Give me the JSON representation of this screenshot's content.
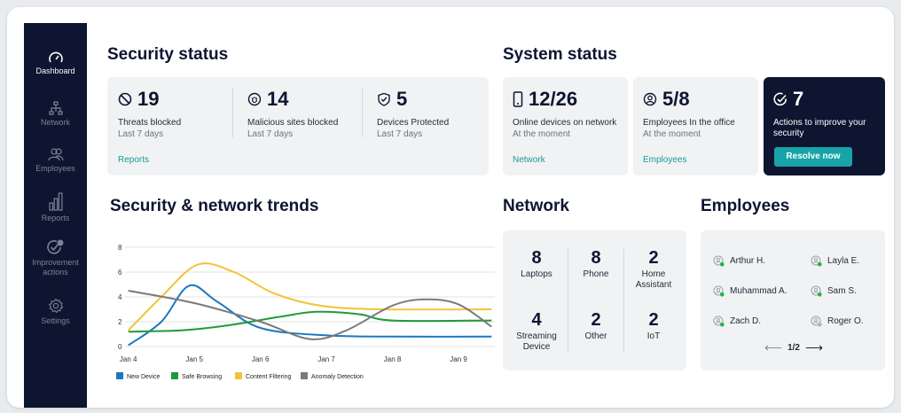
{
  "sidebar": {
    "items": [
      {
        "label": "Dashboard",
        "icon": "gauge-icon",
        "active": true
      },
      {
        "label": "Network",
        "icon": "network-icon",
        "active": false
      },
      {
        "label": "Employees",
        "icon": "users-icon",
        "active": false
      },
      {
        "label": "Reports",
        "icon": "bar-chart-icon",
        "active": false
      },
      {
        "label": "Improvement actions",
        "label_line1": "Improvement",
        "label_line2": "actions",
        "icon": "shield-badge-icon",
        "active": false
      },
      {
        "label": "Settings",
        "icon": "gear-icon",
        "active": false
      }
    ]
  },
  "security_status": {
    "title": "Security status",
    "stats": [
      {
        "value": "19",
        "label": "Threats blocked",
        "sub": "Last 7 days",
        "icon": "block-icon"
      },
      {
        "value": "14",
        "label": "Malicious sites blocked",
        "sub": "Last 7 days",
        "icon": "bug-icon"
      },
      {
        "value": "5",
        "label": "Devices Protected",
        "sub": "Last 7 days",
        "icon": "shield-check-icon"
      }
    ],
    "link": "Reports"
  },
  "system_status": {
    "title": "System status",
    "cards": [
      {
        "value": "12/26",
        "label": "Online devices on network",
        "sub": "At the moment",
        "link": "Network",
        "icon": "phone-icon"
      },
      {
        "value": "5/8",
        "label": "Employees In the office",
        "sub": "At the moment",
        "link": "Employees",
        "icon": "user-circle-icon"
      }
    ],
    "actions": {
      "value": "7",
      "label": "Actions to improve your security",
      "button": "Resolve now",
      "icon": "check-circle-icon"
    }
  },
  "trends": {
    "title": "Security & network trends"
  },
  "network": {
    "title": "Network",
    "cells": [
      {
        "value": "8",
        "label": "Laptops"
      },
      {
        "value": "8",
        "label": "Phone"
      },
      {
        "value": "2",
        "label": "Home Assistant",
        "label_line1": "Home",
        "label_line2": "Assistant"
      },
      {
        "value": "4",
        "label": "Streaming Device",
        "label_line1": "Streaming",
        "label_line2": "Device"
      },
      {
        "value": "2",
        "label": "Other"
      },
      {
        "value": "2",
        "label": "IoT"
      }
    ]
  },
  "employees": {
    "title": "Employees",
    "list": [
      {
        "name": "Arthur H.",
        "status": "online"
      },
      {
        "name": "Layla E.",
        "status": "online"
      },
      {
        "name": "Muhammad A.",
        "status": "online"
      },
      {
        "name": "Sam S.",
        "status": "online"
      },
      {
        "name": "Zach D.",
        "status": "online"
      },
      {
        "name": "Roger O.",
        "status": "offline"
      }
    ],
    "pagination": "1/2"
  },
  "colors": {
    "sidebar": "#0d1530",
    "accent": "#17a3a7",
    "online": "#22b14c",
    "offline": "#b0b5bd"
  },
  "chart_data": {
    "type": "line",
    "x": [
      "Jan 4",
      "Jan 5",
      "Jan 6",
      "Jan 7",
      "Jan 8",
      "Jan 9"
    ],
    "ylim": [
      0,
      8
    ],
    "yticks": [
      "0",
      "2",
      "4",
      "6",
      "8"
    ],
    "grid": true,
    "legend": "bottom",
    "series": [
      {
        "name": "New Device",
        "color": "#1a78c2",
        "points": [
          [
            0,
            0.1
          ],
          [
            0.5,
            2.0
          ],
          [
            0.92,
            4.9
          ],
          [
            1.35,
            3.6
          ],
          [
            2.0,
            1.5
          ],
          [
            3.0,
            0.9
          ],
          [
            4.0,
            0.8
          ],
          [
            5.5,
            0.8
          ]
        ]
      },
      {
        "name": "Safe Browsing",
        "color": "#1f9a3a",
        "points": [
          [
            0,
            1.2
          ],
          [
            0.8,
            1.3
          ],
          [
            1.5,
            1.7
          ],
          [
            2.3,
            2.4
          ],
          [
            2.85,
            2.8
          ],
          [
            3.5,
            2.6
          ],
          [
            4.0,
            2.1
          ],
          [
            5.5,
            2.1
          ]
        ]
      },
      {
        "name": "Content Filtering",
        "color": "#f5c232",
        "points": [
          [
            0,
            1.3
          ],
          [
            0.5,
            4.0
          ],
          [
            1.05,
            6.6
          ],
          [
            1.6,
            6.0
          ],
          [
            2.2,
            4.3
          ],
          [
            2.9,
            3.3
          ],
          [
            3.8,
            3.0
          ],
          [
            5.5,
            3.0
          ]
        ]
      },
      {
        "name": "Anomaly Detection",
        "color": "#7a7a7a",
        "points": [
          [
            0,
            4.5
          ],
          [
            1.0,
            3.5
          ],
          [
            2.0,
            2.0
          ],
          [
            2.75,
            0.6
          ],
          [
            3.3,
            1.3
          ],
          [
            4.0,
            3.3
          ],
          [
            4.5,
            3.8
          ],
          [
            5.0,
            3.4
          ],
          [
            5.5,
            1.6
          ]
        ]
      }
    ]
  }
}
